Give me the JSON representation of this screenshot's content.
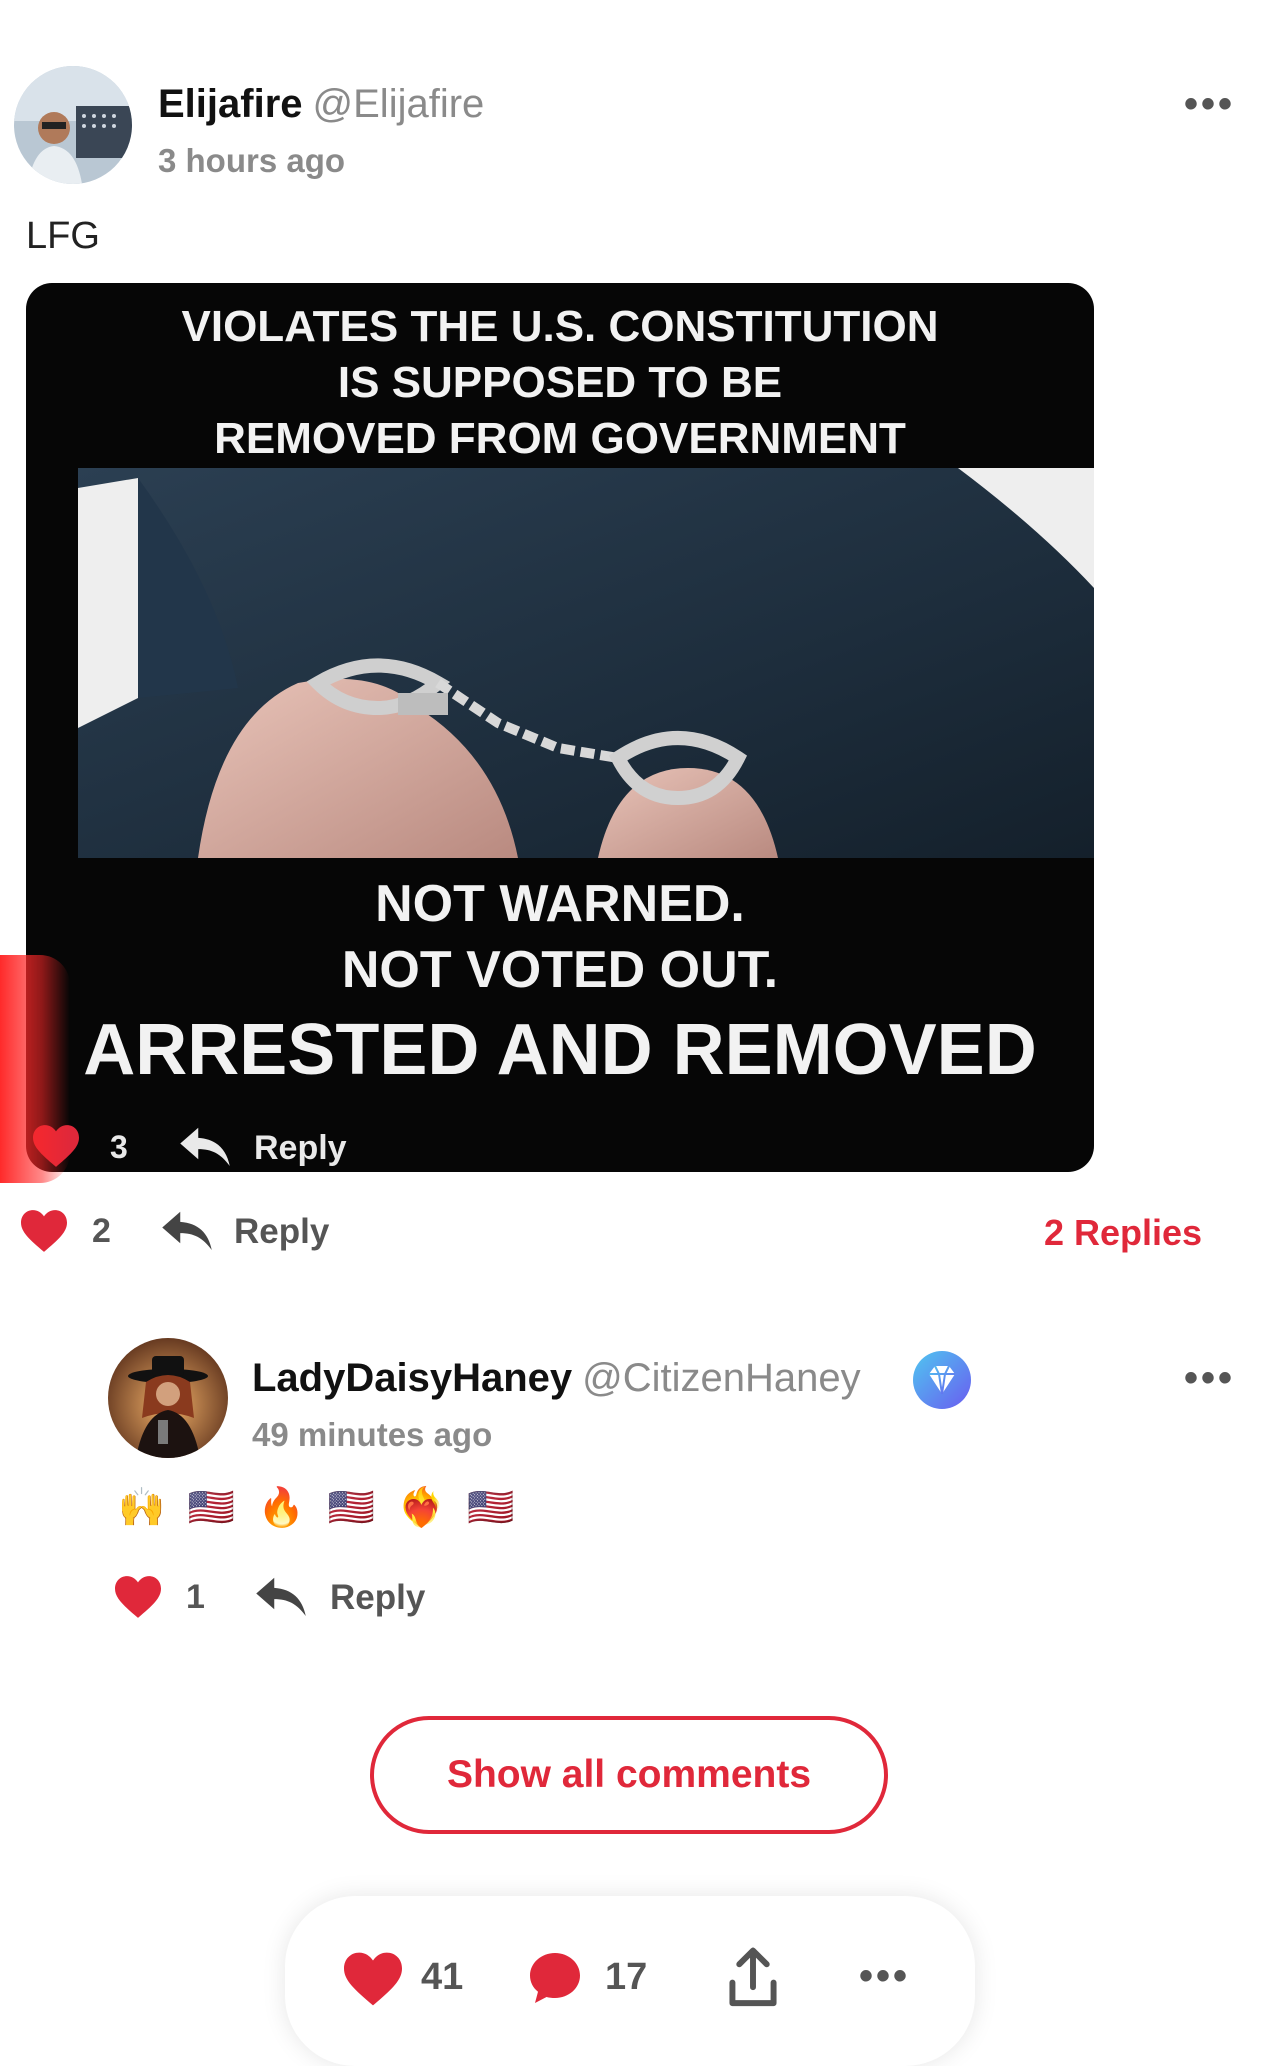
{
  "post": {
    "author_name": "Elijafire",
    "author_handle": "@Elijafire",
    "time": "3 hours ago",
    "text": "LFG",
    "likes": "2",
    "reply_label": "Reply",
    "replies_link": "2 Replies"
  },
  "meme": {
    "top_line1": "VIOLATES THE U.S. CONSTITUTION",
    "top_line2": "IS SUPPOSED TO BE",
    "top_line3": "REMOVED FROM GOVERNMENT",
    "bottom_line1": "NOT WARNED.",
    "bottom_line2": "NOT VOTED OUT.",
    "bottom_line3": "ARRESTED AND REMOVED",
    "embedded_likes": "3",
    "embedded_reply": "Reply"
  },
  "reply": {
    "author_name": "LadyDaisyHaney",
    "author_handle": "@CitizenHaney",
    "time": "49 minutes ago",
    "text": "🙌 🇺🇸 🔥 🇺🇸 ❤️‍🔥 🇺🇸",
    "likes": "1",
    "reply_label": "Reply"
  },
  "show_all_label": "Show all comments",
  "bottom_bar": {
    "likes": "41",
    "comments": "17"
  },
  "colors": {
    "accent": "#e0283a",
    "verified_badge": "#4f8ff7"
  },
  "icons": [
    "more-icon",
    "heart-icon",
    "reply-arrow-icon",
    "comment-bubble-icon",
    "share-icon",
    "verified-badge-icon"
  ]
}
